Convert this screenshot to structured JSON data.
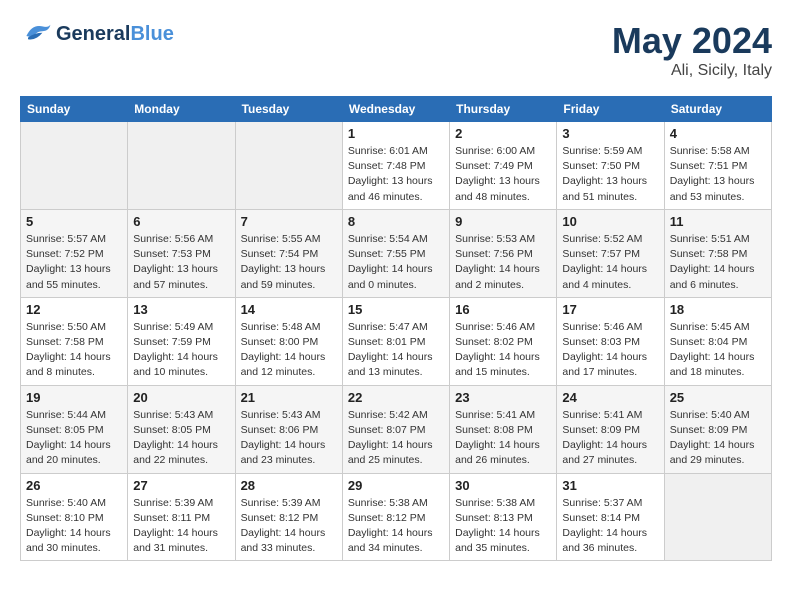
{
  "logo": {
    "line1": "General",
    "line2": "Blue"
  },
  "title": {
    "month": "May 2024",
    "location": "Ali, Sicily, Italy"
  },
  "days_of_week": [
    "Sunday",
    "Monday",
    "Tuesday",
    "Wednesday",
    "Thursday",
    "Friday",
    "Saturday"
  ],
  "weeks": [
    [
      {
        "day": "",
        "info": []
      },
      {
        "day": "",
        "info": []
      },
      {
        "day": "",
        "info": []
      },
      {
        "day": "1",
        "info": [
          "Sunrise: 6:01 AM",
          "Sunset: 7:48 PM",
          "Daylight: 13 hours",
          "and 46 minutes."
        ]
      },
      {
        "day": "2",
        "info": [
          "Sunrise: 6:00 AM",
          "Sunset: 7:49 PM",
          "Daylight: 13 hours",
          "and 48 minutes."
        ]
      },
      {
        "day": "3",
        "info": [
          "Sunrise: 5:59 AM",
          "Sunset: 7:50 PM",
          "Daylight: 13 hours",
          "and 51 minutes."
        ]
      },
      {
        "day": "4",
        "info": [
          "Sunrise: 5:58 AM",
          "Sunset: 7:51 PM",
          "Daylight: 13 hours",
          "and 53 minutes."
        ]
      }
    ],
    [
      {
        "day": "5",
        "info": [
          "Sunrise: 5:57 AM",
          "Sunset: 7:52 PM",
          "Daylight: 13 hours",
          "and 55 minutes."
        ]
      },
      {
        "day": "6",
        "info": [
          "Sunrise: 5:56 AM",
          "Sunset: 7:53 PM",
          "Daylight: 13 hours",
          "and 57 minutes."
        ]
      },
      {
        "day": "7",
        "info": [
          "Sunrise: 5:55 AM",
          "Sunset: 7:54 PM",
          "Daylight: 13 hours",
          "and 59 minutes."
        ]
      },
      {
        "day": "8",
        "info": [
          "Sunrise: 5:54 AM",
          "Sunset: 7:55 PM",
          "Daylight: 14 hours",
          "and 0 minutes."
        ]
      },
      {
        "day": "9",
        "info": [
          "Sunrise: 5:53 AM",
          "Sunset: 7:56 PM",
          "Daylight: 14 hours",
          "and 2 minutes."
        ]
      },
      {
        "day": "10",
        "info": [
          "Sunrise: 5:52 AM",
          "Sunset: 7:57 PM",
          "Daylight: 14 hours",
          "and 4 minutes."
        ]
      },
      {
        "day": "11",
        "info": [
          "Sunrise: 5:51 AM",
          "Sunset: 7:58 PM",
          "Daylight: 14 hours",
          "and 6 minutes."
        ]
      }
    ],
    [
      {
        "day": "12",
        "info": [
          "Sunrise: 5:50 AM",
          "Sunset: 7:58 PM",
          "Daylight: 14 hours",
          "and 8 minutes."
        ]
      },
      {
        "day": "13",
        "info": [
          "Sunrise: 5:49 AM",
          "Sunset: 7:59 PM",
          "Daylight: 14 hours",
          "and 10 minutes."
        ]
      },
      {
        "day": "14",
        "info": [
          "Sunrise: 5:48 AM",
          "Sunset: 8:00 PM",
          "Daylight: 14 hours",
          "and 12 minutes."
        ]
      },
      {
        "day": "15",
        "info": [
          "Sunrise: 5:47 AM",
          "Sunset: 8:01 PM",
          "Daylight: 14 hours",
          "and 13 minutes."
        ]
      },
      {
        "day": "16",
        "info": [
          "Sunrise: 5:46 AM",
          "Sunset: 8:02 PM",
          "Daylight: 14 hours",
          "and 15 minutes."
        ]
      },
      {
        "day": "17",
        "info": [
          "Sunrise: 5:46 AM",
          "Sunset: 8:03 PM",
          "Daylight: 14 hours",
          "and 17 minutes."
        ]
      },
      {
        "day": "18",
        "info": [
          "Sunrise: 5:45 AM",
          "Sunset: 8:04 PM",
          "Daylight: 14 hours",
          "and 18 minutes."
        ]
      }
    ],
    [
      {
        "day": "19",
        "info": [
          "Sunrise: 5:44 AM",
          "Sunset: 8:05 PM",
          "Daylight: 14 hours",
          "and 20 minutes."
        ]
      },
      {
        "day": "20",
        "info": [
          "Sunrise: 5:43 AM",
          "Sunset: 8:05 PM",
          "Daylight: 14 hours",
          "and 22 minutes."
        ]
      },
      {
        "day": "21",
        "info": [
          "Sunrise: 5:43 AM",
          "Sunset: 8:06 PM",
          "Daylight: 14 hours",
          "and 23 minutes."
        ]
      },
      {
        "day": "22",
        "info": [
          "Sunrise: 5:42 AM",
          "Sunset: 8:07 PM",
          "Daylight: 14 hours",
          "and 25 minutes."
        ]
      },
      {
        "day": "23",
        "info": [
          "Sunrise: 5:41 AM",
          "Sunset: 8:08 PM",
          "Daylight: 14 hours",
          "and 26 minutes."
        ]
      },
      {
        "day": "24",
        "info": [
          "Sunrise: 5:41 AM",
          "Sunset: 8:09 PM",
          "Daylight: 14 hours",
          "and 27 minutes."
        ]
      },
      {
        "day": "25",
        "info": [
          "Sunrise: 5:40 AM",
          "Sunset: 8:09 PM",
          "Daylight: 14 hours",
          "and 29 minutes."
        ]
      }
    ],
    [
      {
        "day": "26",
        "info": [
          "Sunrise: 5:40 AM",
          "Sunset: 8:10 PM",
          "Daylight: 14 hours",
          "and 30 minutes."
        ]
      },
      {
        "day": "27",
        "info": [
          "Sunrise: 5:39 AM",
          "Sunset: 8:11 PM",
          "Daylight: 14 hours",
          "and 31 minutes."
        ]
      },
      {
        "day": "28",
        "info": [
          "Sunrise: 5:39 AM",
          "Sunset: 8:12 PM",
          "Daylight: 14 hours",
          "and 33 minutes."
        ]
      },
      {
        "day": "29",
        "info": [
          "Sunrise: 5:38 AM",
          "Sunset: 8:12 PM",
          "Daylight: 14 hours",
          "and 34 minutes."
        ]
      },
      {
        "day": "30",
        "info": [
          "Sunrise: 5:38 AM",
          "Sunset: 8:13 PM",
          "Daylight: 14 hours",
          "and 35 minutes."
        ]
      },
      {
        "day": "31",
        "info": [
          "Sunrise: 5:37 AM",
          "Sunset: 8:14 PM",
          "Daylight: 14 hours",
          "and 36 minutes."
        ]
      },
      {
        "day": "",
        "info": []
      }
    ]
  ]
}
